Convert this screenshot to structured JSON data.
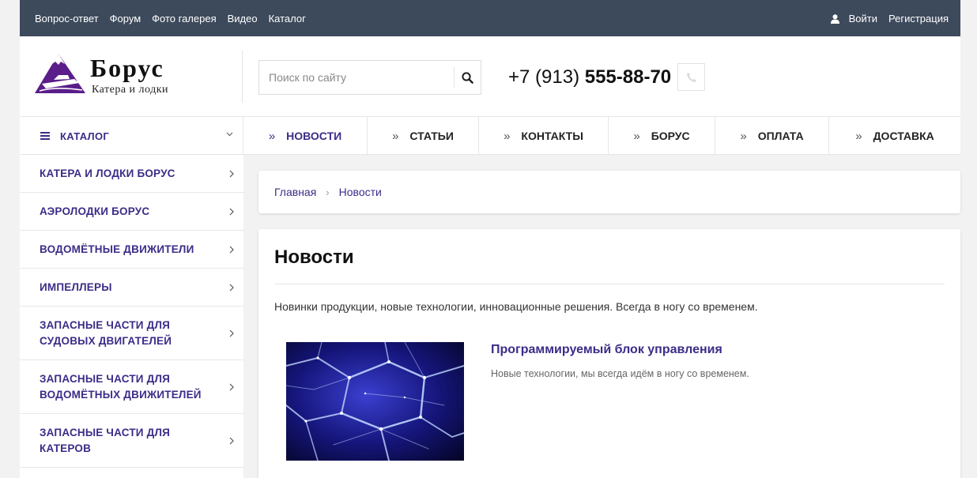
{
  "topbar": {
    "links": [
      "Вопрос-ответ",
      "Форум",
      "Фото галерея",
      "Видео",
      "Каталог"
    ],
    "login": "Войти",
    "register": "Регистрация",
    "bg_color": "#3d4a5c"
  },
  "header": {
    "brand": "Борус",
    "tagline": "Катера и лодки",
    "search_placeholder": "Поиск по сайту",
    "phone_prefix": "+7 (913)",
    "phone_main": "555-88-70"
  },
  "nav": {
    "catalog_label": "КАТАЛОГ",
    "items": [
      "НОВОСТИ",
      "СТАТЬИ",
      "КОНТАКТЫ",
      "БОРУС",
      "ОПЛАТА",
      "ДОСТАВКА"
    ],
    "active_item": "НОВОСТИ"
  },
  "sidebar": {
    "items": [
      "КАТЕРА И ЛОДКИ БОРУС",
      "АЭРОЛОДКИ БОРУС",
      "ВОДОМЁТНЫЕ ДВИЖИТЕЛИ",
      "ИМПЕЛЛЕРЫ",
      "ЗАПАСНЫЕ ЧАСТИ ДЛЯ СУДОВЫХ ДВИГАТЕЛЕЙ",
      "ЗАПАСНЫЕ ЧАСТИ ДЛЯ ВОДОМЁТНЫХ ДВИЖИТЕЛЕЙ",
      "ЗАПАСНЫЕ ЧАСТИ ДЛЯ КАТЕРОВ"
    ]
  },
  "breadcrumbs": {
    "home": "Главная",
    "current": "Новости"
  },
  "content": {
    "title": "Новости",
    "intro": "Новинки продукции, новые технологии, инновационные решения. Всегда в ногу со временем.",
    "news": [
      {
        "title": "Программируемый блок управления",
        "description": "Новые технологии, мы всегда идём в ногу со временем."
      }
    ]
  },
  "colors": {
    "accent": "#3a2d88",
    "logo": "#5a1d8a"
  }
}
